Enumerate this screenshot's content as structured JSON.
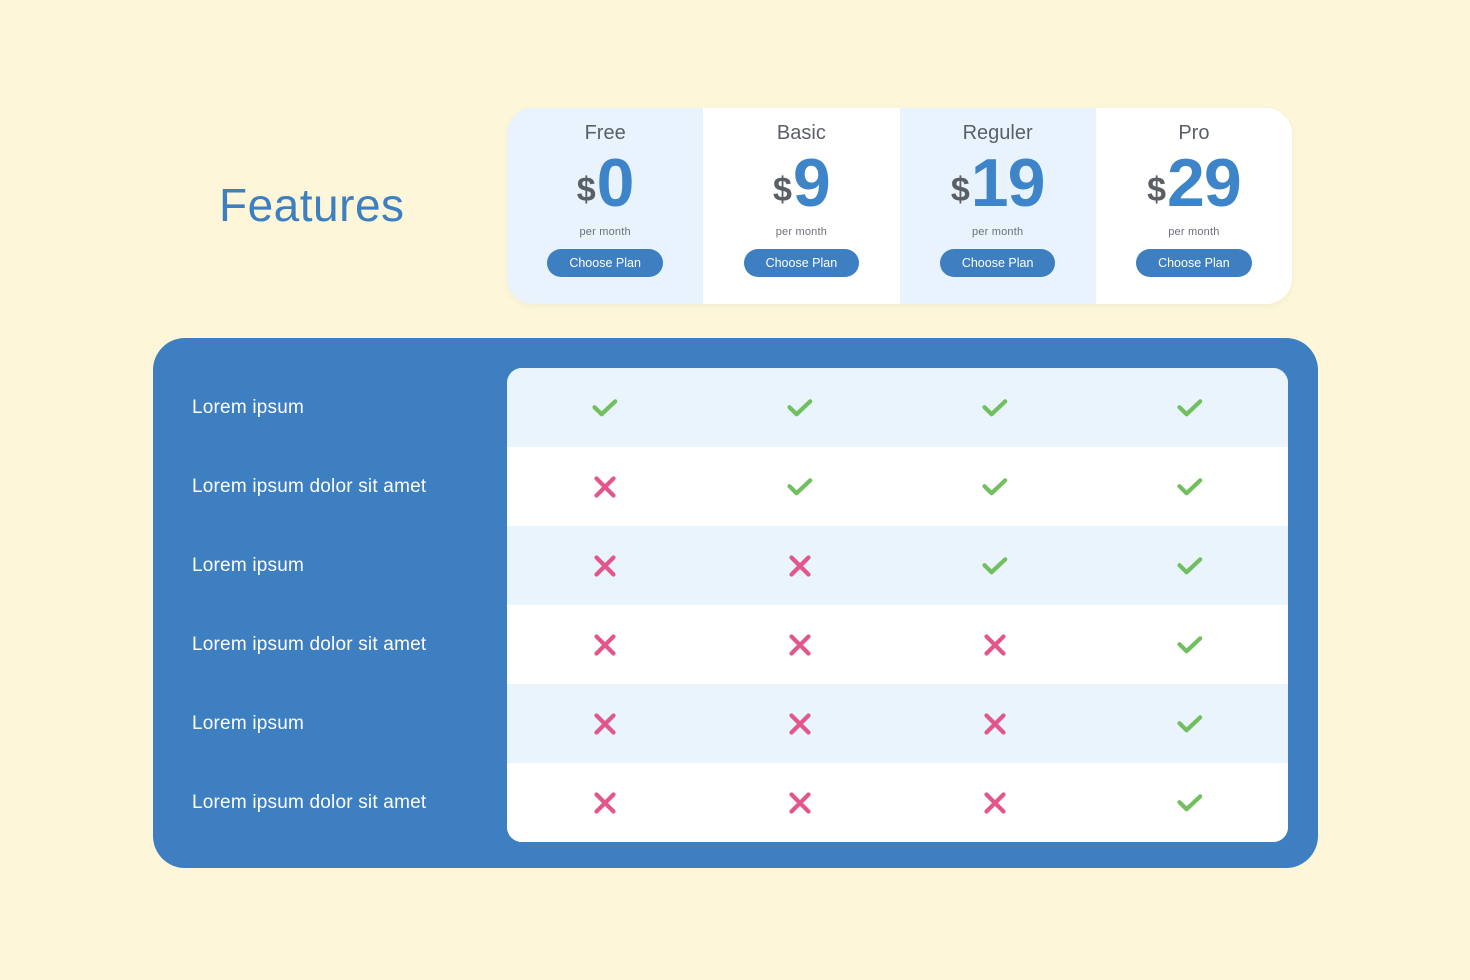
{
  "page": {
    "background_color": "#FDF6D8",
    "title": "Features"
  },
  "colors": {
    "accent_blue": "#3d7fc1",
    "price_blue": "#3d85c8",
    "card_tint": "#e8f3fd",
    "row_tint": "#e9f4fd",
    "check_green": "#72bf5f",
    "cross_pink": "#e2568c",
    "panel_blue": "#3d7fc1",
    "heading_gray": "#5a5f66"
  },
  "plans": [
    {
      "name": "Free",
      "currency": "$",
      "amount": "0",
      "period": "per month",
      "cta": "Choose Plan",
      "style": "tint"
    },
    {
      "name": "Basic",
      "currency": "$",
      "amount": "9",
      "period": "per month",
      "cta": "Choose Plan",
      "style": "plain"
    },
    {
      "name": "Reguler",
      "currency": "$",
      "amount": "19",
      "period": "per month",
      "cta": "Choose Plan",
      "style": "tint"
    },
    {
      "name": "Pro",
      "currency": "$",
      "amount": "29",
      "period": "per month",
      "cta": "Choose Plan",
      "style": "plain"
    }
  ],
  "comparison": {
    "columns": [
      "Free",
      "Basic",
      "Reguler",
      "Pro"
    ],
    "rows": [
      {
        "label": "Lorem ipsum",
        "values": [
          "check",
          "check",
          "check",
          "check"
        ]
      },
      {
        "label": "Lorem ipsum dolor sit amet",
        "values": [
          "cross",
          "check",
          "check",
          "check"
        ]
      },
      {
        "label": "Lorem ipsum",
        "values": [
          "cross",
          "cross",
          "check",
          "check"
        ]
      },
      {
        "label": "Lorem ipsum dolor sit amet",
        "values": [
          "cross",
          "cross",
          "cross",
          "check"
        ]
      },
      {
        "label": "Lorem ipsum",
        "values": [
          "cross",
          "cross",
          "cross",
          "check"
        ]
      },
      {
        "label": "Lorem ipsum dolor sit amet",
        "values": [
          "cross",
          "cross",
          "cross",
          "check"
        ]
      }
    ]
  },
  "icons": {
    "check": "check-icon",
    "cross": "cross-icon"
  }
}
